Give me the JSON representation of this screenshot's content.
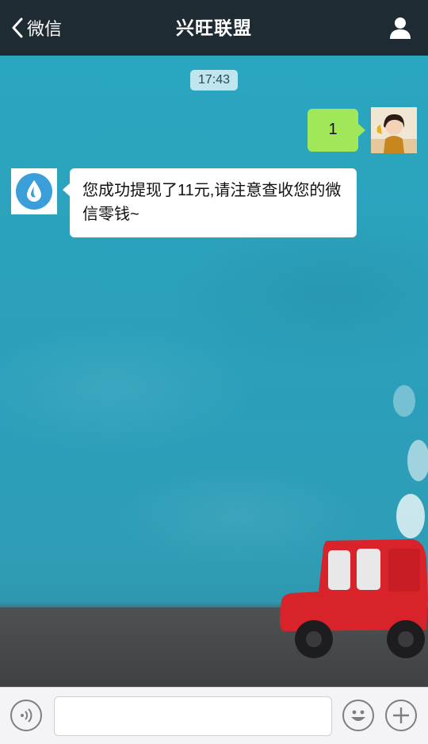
{
  "navbar": {
    "back_label": "微信",
    "title": "兴旺联盟",
    "back_icon": "chevron-left-icon",
    "profile_icon": "person-icon"
  },
  "chat": {
    "timestamp": "17:43",
    "messages": [
      {
        "sender": "me",
        "text": "1",
        "bubble_color": "#a0e75a"
      },
      {
        "sender": "bot",
        "text": "您成功提现了11元,请注意查收您的微信零钱~",
        "bubble_color": "#ffffff"
      }
    ],
    "bot_avatar_icon": "water-drop-icon",
    "user_avatar": "user-photo-avatar"
  },
  "input_bar": {
    "value": "",
    "placeholder": "",
    "voice_icon": "voice-icon",
    "emoji_icon": "emoji-icon",
    "plus_icon": "plus-icon"
  },
  "colors": {
    "navbar_bg": "#1f2b33",
    "chat_bg": "#2aa3bd",
    "my_bubble": "#a0e75a",
    "bot_icon_blue": "#3a9fd8",
    "car_red": "#d8232a"
  }
}
